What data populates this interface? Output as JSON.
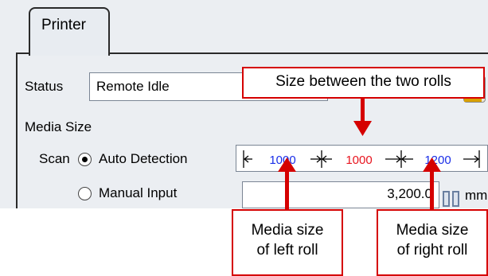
{
  "tabs": {
    "printer": "Printer"
  },
  "status": {
    "label": "Status",
    "value": "Remote Idle"
  },
  "media": {
    "title": "Media Size",
    "scan_label": "Scan",
    "auto_label": "Auto Detection",
    "manual_label": "Manual Input",
    "manual_value": "3,200.0",
    "unit": "mm",
    "sizes": {
      "left": "1000",
      "middle": "1000",
      "right": "1200"
    }
  },
  "callouts": {
    "between": "Size between the two rolls",
    "left_line1": "Media size",
    "left_line2": "of left roll",
    "right_line1": "Media size",
    "right_line2": "of right roll"
  },
  "colors": {
    "callout_red": "#d50000",
    "size_blue": "#1a2ee8",
    "size_red": "#e8141e"
  }
}
